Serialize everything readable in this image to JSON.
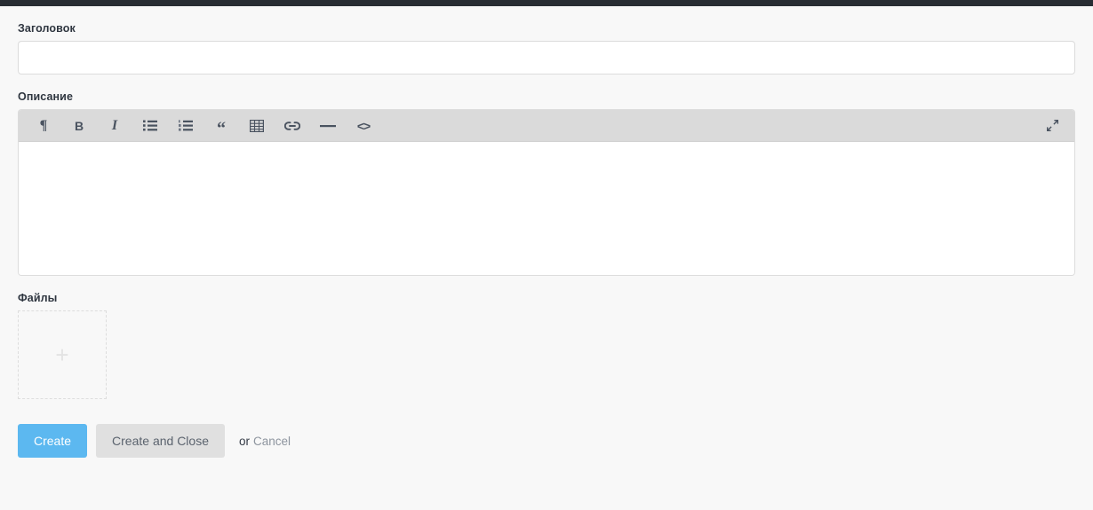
{
  "page": {
    "background_color": "#f8f8f8",
    "topbar_color": "#282d33"
  },
  "form": {
    "title_field": {
      "label": "Заголовок",
      "value": "",
      "placeholder": ""
    },
    "description_field": {
      "label": "Описание",
      "value": "",
      "placeholder": ""
    },
    "files_field": {
      "label": "Файлы",
      "add_icon": "plus-icon",
      "add_glyph": "+"
    }
  },
  "toolbar": {
    "items": [
      {
        "name": "paragraph-icon",
        "glyph": "¶",
        "title": "Paragraph"
      },
      {
        "name": "bold-icon",
        "glyph": "B",
        "title": "Bold"
      },
      {
        "name": "italic-icon",
        "glyph": "I",
        "title": "Italic"
      },
      {
        "name": "bulleted-list-icon",
        "glyph": "",
        "title": "Bulleted list"
      },
      {
        "name": "numbered-list-icon",
        "glyph": "",
        "title": "Numbered list"
      },
      {
        "name": "blockquote-icon",
        "glyph": "“",
        "title": "Quote"
      },
      {
        "name": "table-icon",
        "glyph": "",
        "title": "Table"
      },
      {
        "name": "link-icon",
        "glyph": "",
        "title": "Link"
      },
      {
        "name": "horizontal-rule-icon",
        "glyph": "—",
        "title": "Horizontal rule"
      },
      {
        "name": "code-icon",
        "glyph": "<>",
        "title": "Code"
      }
    ],
    "expand": {
      "name": "expand-icon",
      "title": "Fullscreen"
    }
  },
  "actions": {
    "create_label": "Create",
    "create_and_close_label": "Create and Close",
    "or_label": "or",
    "cancel_label": "Cancel",
    "primary_color": "#5cb8f0",
    "secondary_color": "#e0e0e0"
  }
}
